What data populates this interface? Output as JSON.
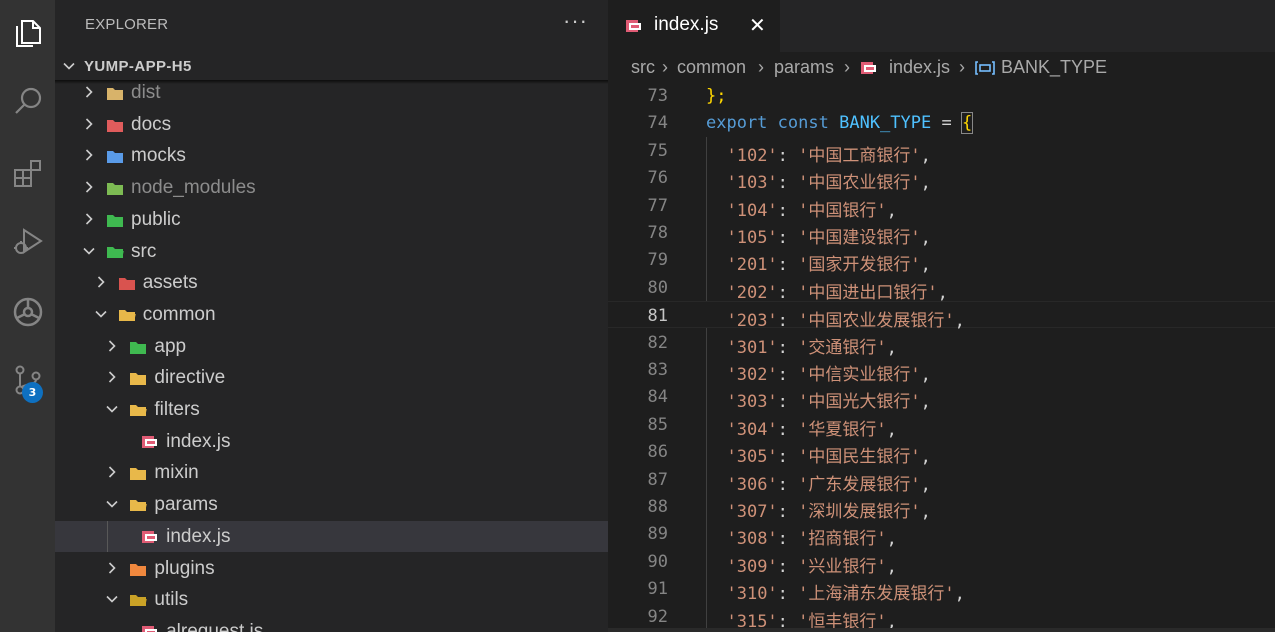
{
  "activity_bar": {
    "items": [
      {
        "icon": "files-icon",
        "active": true
      },
      {
        "icon": "search-icon"
      },
      {
        "icon": "extensions-icon"
      },
      {
        "icon": "run-debug-icon"
      },
      {
        "icon": "remote-icon"
      },
      {
        "icon": "source-control-icon",
        "badge": "3"
      }
    ]
  },
  "sidebar": {
    "title": "EXPLORER",
    "more": "···",
    "root": "YUMP-APP-H5",
    "tree": [
      {
        "label": "dist",
        "depth": 0,
        "expanded": false,
        "folder": true,
        "dim": true,
        "icon": "dist-folder-icon",
        "color": "#d8b36a"
      },
      {
        "label": "docs",
        "depth": 0,
        "expanded": false,
        "folder": true,
        "icon": "docs-folder-icon",
        "color": "#e05c5c"
      },
      {
        "label": "mocks",
        "depth": 0,
        "expanded": false,
        "folder": true,
        "icon": "mocks-folder-icon",
        "color": "#5a9be8"
      },
      {
        "label": "node_modules",
        "depth": 0,
        "expanded": false,
        "folder": true,
        "dim": true,
        "icon": "node-modules-folder-icon",
        "color": "#7dbb53"
      },
      {
        "label": "public",
        "depth": 0,
        "expanded": false,
        "folder": true,
        "icon": "public-folder-icon",
        "color": "#3fb950"
      },
      {
        "label": "src",
        "depth": 0,
        "expanded": true,
        "folder": true,
        "icon": "src-folder-icon",
        "color": "#3fb950"
      },
      {
        "label": "assets",
        "depth": 1,
        "expanded": false,
        "folder": true,
        "icon": "assets-folder-icon",
        "color": "#d9534f"
      },
      {
        "label": "common",
        "depth": 1,
        "expanded": true,
        "folder": true,
        "icon": "folder-open-icon",
        "color": "#e8b84a"
      },
      {
        "label": "app",
        "depth": 2,
        "expanded": false,
        "folder": true,
        "icon": "app-folder-icon",
        "color": "#3fb950"
      },
      {
        "label": "directive",
        "depth": 2,
        "expanded": false,
        "folder": true,
        "icon": "folder-icon",
        "color": "#e8b84a"
      },
      {
        "label": "filters",
        "depth": 2,
        "expanded": true,
        "folder": true,
        "icon": "folder-open-icon",
        "color": "#e8b84a"
      },
      {
        "label": "index.js",
        "depth": 3,
        "folder": false,
        "icon": "js-file-icon",
        "color": "#e05c75"
      },
      {
        "label": "mixin",
        "depth": 2,
        "expanded": false,
        "folder": true,
        "icon": "folder-icon",
        "color": "#e8b84a"
      },
      {
        "label": "params",
        "depth": 2,
        "expanded": true,
        "folder": true,
        "icon": "folder-open-icon",
        "color": "#e8b84a"
      },
      {
        "label": "index.js",
        "depth": 3,
        "folder": false,
        "selected": true,
        "icon": "js-file-icon",
        "color": "#e05c75"
      },
      {
        "label": "plugins",
        "depth": 2,
        "expanded": false,
        "folder": true,
        "icon": "plugins-folder-icon",
        "color": "#f0883e"
      },
      {
        "label": "utils",
        "depth": 2,
        "expanded": true,
        "folder": true,
        "icon": "utils-folder-icon",
        "color": "#c9a227"
      },
      {
        "label": "alrequest.js",
        "depth": 3,
        "folder": false,
        "icon": "js-file-icon",
        "color": "#e05c75"
      }
    ]
  },
  "editor": {
    "tab": {
      "label": "index.js",
      "close": "✕"
    },
    "breadcrumbs": [
      "src",
      "common",
      "params",
      "index.js",
      "BANK_TYPE"
    ],
    "current_line": "81",
    "lines": [
      {
        "n": "73",
        "code": [
          {
            "t": "};",
            "c": "br"
          }
        ]
      },
      {
        "n": "74",
        "code": [
          {
            "t": "export",
            "c": "kw"
          },
          {
            "t": " "
          },
          {
            "t": "const",
            "c": "kw"
          },
          {
            "t": " "
          },
          {
            "t": "BANK_TYPE",
            "c": "cn"
          },
          {
            "t": " = "
          },
          {
            "t": "{",
            "c": "brbox"
          }
        ]
      },
      {
        "n": "75",
        "code": [
          {
            "t": "  "
          },
          {
            "t": "'102'",
            "c": "str"
          },
          {
            "t": ": "
          },
          {
            "t": "'中国工商银行'",
            "c": "str"
          },
          {
            "t": ","
          }
        ]
      },
      {
        "n": "76",
        "code": [
          {
            "t": "  "
          },
          {
            "t": "'103'",
            "c": "str"
          },
          {
            "t": ": "
          },
          {
            "t": "'中国农业银行'",
            "c": "str"
          },
          {
            "t": ","
          }
        ]
      },
      {
        "n": "77",
        "code": [
          {
            "t": "  "
          },
          {
            "t": "'104'",
            "c": "str"
          },
          {
            "t": ": "
          },
          {
            "t": "'中国银行'",
            "c": "str"
          },
          {
            "t": ","
          }
        ]
      },
      {
        "n": "78",
        "code": [
          {
            "t": "  "
          },
          {
            "t": "'105'",
            "c": "str"
          },
          {
            "t": ": "
          },
          {
            "t": "'中国建设银行'",
            "c": "str"
          },
          {
            "t": ","
          }
        ]
      },
      {
        "n": "79",
        "code": [
          {
            "t": "  "
          },
          {
            "t": "'201'",
            "c": "str"
          },
          {
            "t": ": "
          },
          {
            "t": "'国家开发银行'",
            "c": "str"
          },
          {
            "t": ","
          }
        ]
      },
      {
        "n": "80",
        "code": [
          {
            "t": "  "
          },
          {
            "t": "'202'",
            "c": "str"
          },
          {
            "t": ": "
          },
          {
            "t": "'中国进出口银行'",
            "c": "str"
          },
          {
            "t": ","
          }
        ]
      },
      {
        "n": "81",
        "code": [
          {
            "t": "  "
          },
          {
            "t": "'203'",
            "c": "str"
          },
          {
            "t": ": "
          },
          {
            "t": "'中国农业发展银行'",
            "c": "str"
          },
          {
            "t": ","
          }
        ]
      },
      {
        "n": "82",
        "code": [
          {
            "t": "  "
          },
          {
            "t": "'301'",
            "c": "str"
          },
          {
            "t": ": "
          },
          {
            "t": "'交通银行'",
            "c": "str"
          },
          {
            "t": ","
          }
        ]
      },
      {
        "n": "83",
        "code": [
          {
            "t": "  "
          },
          {
            "t": "'302'",
            "c": "str"
          },
          {
            "t": ": "
          },
          {
            "t": "'中信实业银行'",
            "c": "str"
          },
          {
            "t": ","
          }
        ]
      },
      {
        "n": "84",
        "code": [
          {
            "t": "  "
          },
          {
            "t": "'303'",
            "c": "str"
          },
          {
            "t": ": "
          },
          {
            "t": "'中国光大银行'",
            "c": "str"
          },
          {
            "t": ","
          }
        ]
      },
      {
        "n": "85",
        "code": [
          {
            "t": "  "
          },
          {
            "t": "'304'",
            "c": "str"
          },
          {
            "t": ": "
          },
          {
            "t": "'华夏银行'",
            "c": "str"
          },
          {
            "t": ","
          }
        ]
      },
      {
        "n": "86",
        "code": [
          {
            "t": "  "
          },
          {
            "t": "'305'",
            "c": "str"
          },
          {
            "t": ": "
          },
          {
            "t": "'中国民生银行'",
            "c": "str"
          },
          {
            "t": ","
          }
        ]
      },
      {
        "n": "87",
        "code": [
          {
            "t": "  "
          },
          {
            "t": "'306'",
            "c": "str"
          },
          {
            "t": ": "
          },
          {
            "t": "'广东发展银行'",
            "c": "str"
          },
          {
            "t": ","
          }
        ]
      },
      {
        "n": "88",
        "code": [
          {
            "t": "  "
          },
          {
            "t": "'307'",
            "c": "str"
          },
          {
            "t": ": "
          },
          {
            "t": "'深圳发展银行'",
            "c": "str"
          },
          {
            "t": ","
          }
        ]
      },
      {
        "n": "89",
        "code": [
          {
            "t": "  "
          },
          {
            "t": "'308'",
            "c": "str"
          },
          {
            "t": ": "
          },
          {
            "t": "'招商银行'",
            "c": "str"
          },
          {
            "t": ","
          }
        ]
      },
      {
        "n": "90",
        "code": [
          {
            "t": "  "
          },
          {
            "t": "'309'",
            "c": "str"
          },
          {
            "t": ": "
          },
          {
            "t": "'兴业银行'",
            "c": "str"
          },
          {
            "t": ","
          }
        ]
      },
      {
        "n": "91",
        "code": [
          {
            "t": "  "
          },
          {
            "t": "'310'",
            "c": "str"
          },
          {
            "t": ": "
          },
          {
            "t": "'上海浦东发展银行'",
            "c": "str"
          },
          {
            "t": ","
          }
        ]
      },
      {
        "n": "92",
        "code": [
          {
            "t": "  "
          },
          {
            "t": "'315'",
            "c": "str"
          },
          {
            "t": ": "
          },
          {
            "t": "'恒丰银行'",
            "c": "str"
          },
          {
            "t": ","
          }
        ]
      }
    ]
  },
  "colors": {
    "accent": "#0e70c0",
    "keyword": "#569cd6",
    "constant": "#4fc1ff",
    "string": "#ce9178",
    "bracket": "#ffd700"
  }
}
